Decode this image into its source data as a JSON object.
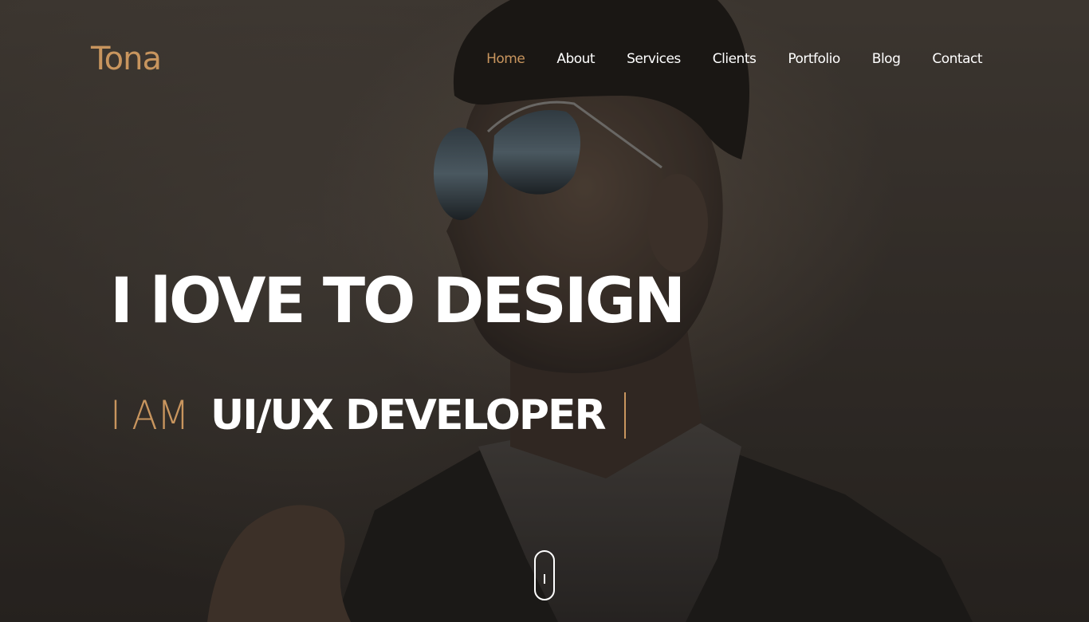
{
  "brand": {
    "logo_text": "Tona",
    "accent_color": "#c8955e"
  },
  "nav": {
    "items": [
      {
        "label": "Home",
        "active": true
      },
      {
        "label": "About",
        "active": false
      },
      {
        "label": "Services",
        "active": false
      },
      {
        "label": "Clients",
        "active": false
      },
      {
        "label": "Portfolio",
        "active": false
      },
      {
        "label": "Blog",
        "active": false
      },
      {
        "label": "Contact",
        "active": false
      }
    ]
  },
  "hero": {
    "headline": "I lOVE TO DESIGN",
    "subline_prefix": "I AM",
    "subline_role": "UI/UX DEVELOPER",
    "background": "man-with-aviator-sunglasses-photo"
  },
  "scroll_indicator": {
    "icon": "mouse-scroll-icon"
  }
}
